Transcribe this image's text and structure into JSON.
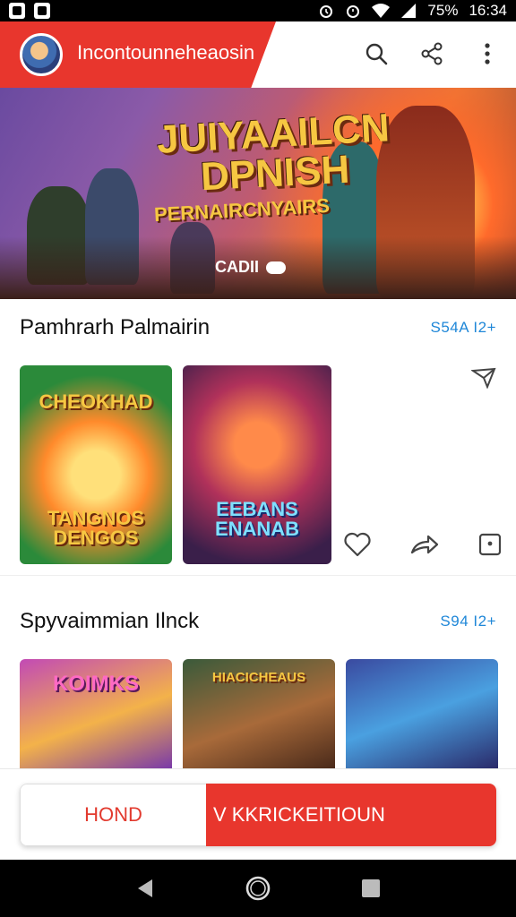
{
  "status_bar": {
    "battery": "75%",
    "time": "16:34",
    "icons": [
      "notification-icon",
      "image-icon",
      "alarm-icon",
      "alarm-icon",
      "wifi-icon",
      "signal-icon"
    ]
  },
  "app_bar": {
    "title": "Incontounneheaosin",
    "accent_color": "#e8362d",
    "actions": [
      "search-icon",
      "share-icon",
      "more-vert-icon"
    ]
  },
  "banner": {
    "title_line1": "JUIYAAILCN",
    "title_line2": "DPNISH",
    "subtitle": "PERNAIRCNYAIRS",
    "pill_label": "CADII"
  },
  "section1": {
    "title": "Pamhrarh Palmairin",
    "more": "S54A I2+",
    "cards": [
      {
        "label_top": "CHEOKHAD",
        "label_bottom": "TANGNOS DENGOS"
      },
      {
        "label_top": "",
        "label_bottom": "EEBANS ENANAB"
      }
    ],
    "actions": [
      "heart-icon",
      "share-icon",
      "bookmark-icon"
    ]
  },
  "section2": {
    "title": "Spyvaimmian Ilnck",
    "more": "S94 I2+",
    "cards": [
      {
        "label_top": "KOIMKS"
      },
      {
        "label_top": "HIACICHEAUS"
      },
      {
        "label_top": ""
      }
    ]
  },
  "cta": {
    "left_label": "HOND",
    "right_label": "V KKRICKEITIOUN",
    "accent_color": "#e8362d"
  },
  "nav_bar": {
    "icons": [
      "back-icon",
      "home-icon",
      "recents-icon"
    ]
  }
}
